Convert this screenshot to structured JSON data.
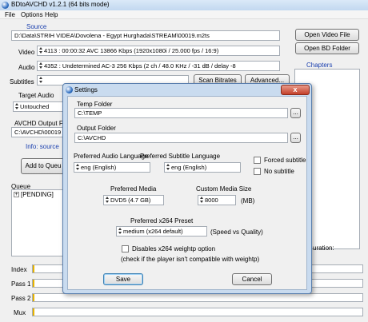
{
  "window": {
    "title": "BDtoAVCHD v1.2.1   (64 bits mode)"
  },
  "menu": [
    "File",
    "Options",
    "Help"
  ],
  "source": {
    "group_label": "Source",
    "path": "D:\\Data\\STRIH VIDEA\\Dovolena - Egypt Hurghada\\STREAM\\00019.m2ts",
    "video_label": "Video",
    "video_value": "4113 :  00:00:32  AVC  13866 Kbps  (1920x1080i / 25.000 fps / 16:9)",
    "audio_label": "Audio",
    "audio_value": "4352 :  Undetermined  AC-3  256 Kbps  (2 ch / 48.0 KHz / -31 dB / delay -8",
    "subtitles_label": "Subtitles",
    "scan_bitrates": "Scan Bitrates",
    "advanced": "Advanced...",
    "open_video_file": "Open Video File",
    "open_bd_folder": "Open BD Folder",
    "chapters_label": "Chapters"
  },
  "target": {
    "audio_label": "Target Audio",
    "audio_value": "Untouched",
    "output_label": "AVCHD Output F",
    "output_value": "C:\\AVCHD\\00019",
    "info_text": "Info: source",
    "add_to_queue": "Add to Queu",
    "duration_label": "uration:"
  },
  "queue": {
    "label": "Queue",
    "items": [
      "[PENDING]"
    ]
  },
  "progress": [
    {
      "label": "Index",
      "value": 0
    },
    {
      "label": "Pass 1",
      "value": 0
    },
    {
      "label": "Pass 2",
      "value": 0
    },
    {
      "label": "Mux",
      "value": 0
    }
  ],
  "settings": {
    "title": "Settings",
    "temp_folder_label": "Temp Folder",
    "temp_folder_value": "C:\\TEMP",
    "output_folder_label": "Output Folder",
    "output_folder_value": "C:\\AVCHD",
    "browse": "...",
    "pref_audio_label": "Preferred Audio Language",
    "pref_audio_value": "eng (English)",
    "pref_sub_label": "Preferred Subtitle Language",
    "pref_sub_value": "eng (English)",
    "forced_subtitle": "Forced subtitle",
    "no_subtitle": "No subtitle",
    "pref_media_label": "Preferred Media",
    "pref_media_value": "DVD5  (4.7 GB)",
    "custom_size_label": "Custom Media Size",
    "custom_size_value": "8000",
    "custom_size_unit": "(MB)",
    "x264_label": "Preferred x264 Preset",
    "x264_value": "medium  (x264 default)",
    "x264_hint": "(Speed vs Quality)",
    "weightp_label": "Disables x264 weightp option",
    "weightp_hint": "(check if the player isn't compatible with weightp)",
    "save": "Save",
    "cancel": "Cancel",
    "close": "x"
  }
}
